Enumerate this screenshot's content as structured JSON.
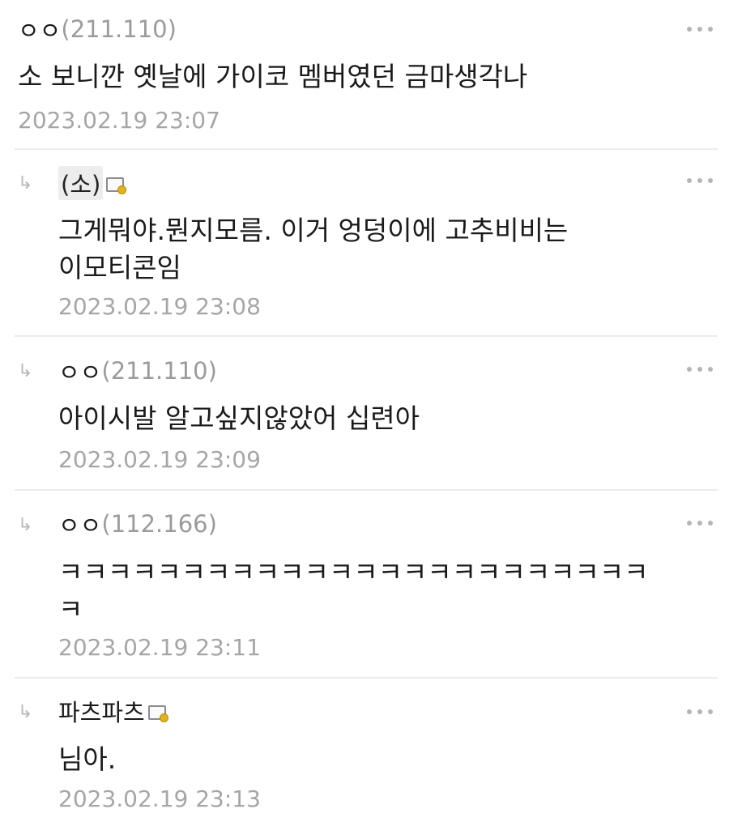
{
  "comments": [
    {
      "author_name": "ㅇㅇ",
      "author_ip": "(211.110)",
      "text": "소 보니깐 옛날에 가이코 멤버였던 금마생각나",
      "date": "2023.02.19 23:07"
    },
    {
      "reply_arrow": "↳",
      "author_name": "(소)",
      "author_ip": "",
      "text": "그게뭐야.뭔지모름. 이거 엉덩이에 고추비비는\n이모티콘임",
      "date": "2023.02.19 23:08"
    },
    {
      "reply_arrow": "↳",
      "author_name": "ㅇㅇ",
      "author_ip": "(211.110)",
      "text": "아이시발 알고싶지않았어 십련아",
      "date": "2023.02.19 23:09"
    },
    {
      "reply_arrow": "↳",
      "author_name": "ㅇㅇ",
      "author_ip": "(112.166)",
      "text": "ㅋㅋㅋㅋㅋㅋㅋㅋㅋㅋㅋㅋㅋㅋㅋㅋㅋㅋㅋㅋㅋㅋㅋㅋ\nㅋ",
      "date": "2023.02.19 23:11"
    },
    {
      "reply_arrow": "↳",
      "author_name": "파츠파츠",
      "author_ip": "",
      "text": "님아.",
      "date": "2023.02.19 23:13"
    }
  ]
}
